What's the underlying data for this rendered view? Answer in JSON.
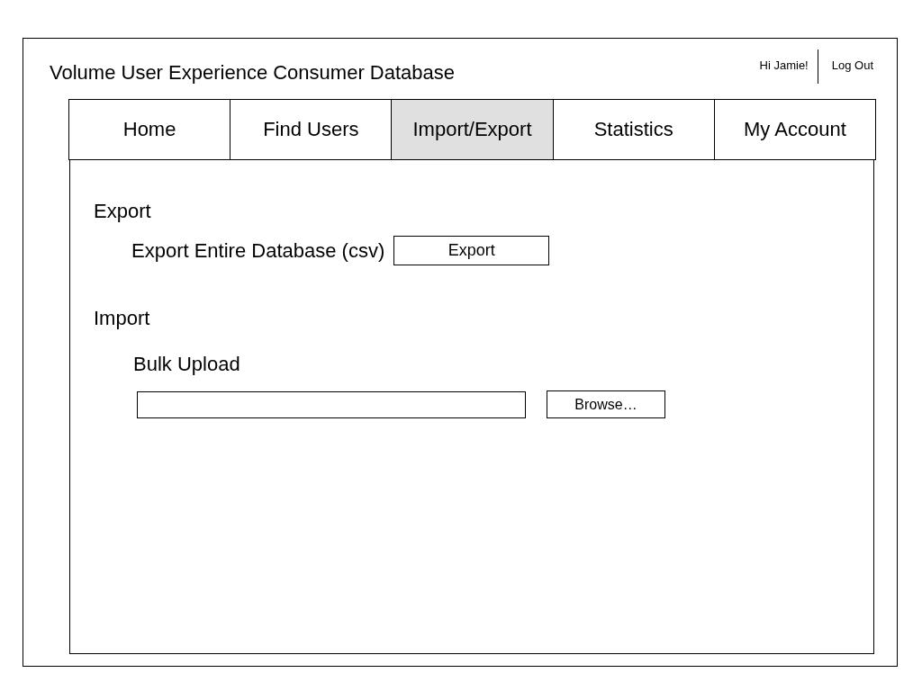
{
  "header": {
    "title": "Volume User Experience Consumer Database",
    "greeting": "Hi Jamie!",
    "logout": "Log Out"
  },
  "tabs": [
    {
      "label": "Home",
      "selected": false
    },
    {
      "label": "Find Users",
      "selected": false
    },
    {
      "label": "Import/Export",
      "selected": true
    },
    {
      "label": "Statistics",
      "selected": false
    },
    {
      "label": "My Account",
      "selected": false
    }
  ],
  "export": {
    "heading": "Export",
    "label": "Export Entire Database (csv)",
    "button": "Export"
  },
  "import": {
    "heading": "Import",
    "label": "Bulk Upload",
    "button": "Browse…"
  }
}
